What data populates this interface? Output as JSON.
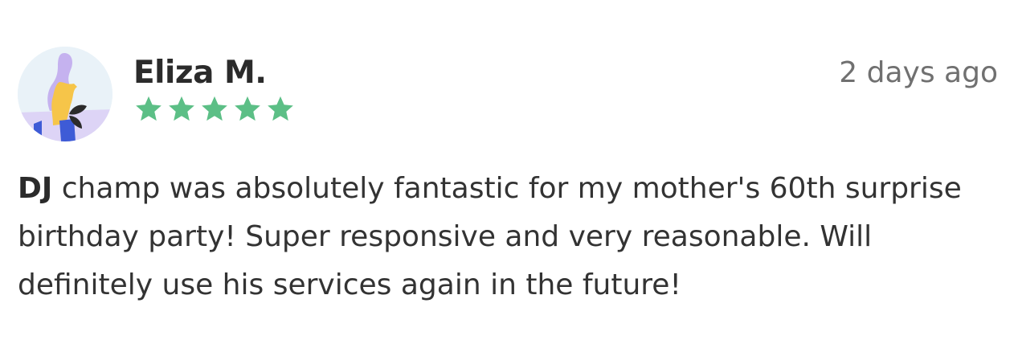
{
  "review": {
    "reviewer_name": "Eliza M.",
    "timestamp": "2 days ago",
    "rating": 5,
    "rating_max": 5,
    "body_emphasis": "DJ",
    "body_text": " champ was absolutely fantastic for my mother's 60th surprise birthday party! Super responsive and very reasonable. Will definitely use his services again in the future!"
  },
  "icons": {
    "star": "star-icon",
    "avatar": "avatar-illustration"
  },
  "colors": {
    "star": "#5cbf86",
    "avatar_bg": "#e9f2f8",
    "avatar_purple": "#c5b2ef",
    "avatar_yellow": "#f6c549",
    "avatar_blue": "#3e5bd6",
    "name_text": "#2b2b2b",
    "timestamp_text": "#707070"
  }
}
